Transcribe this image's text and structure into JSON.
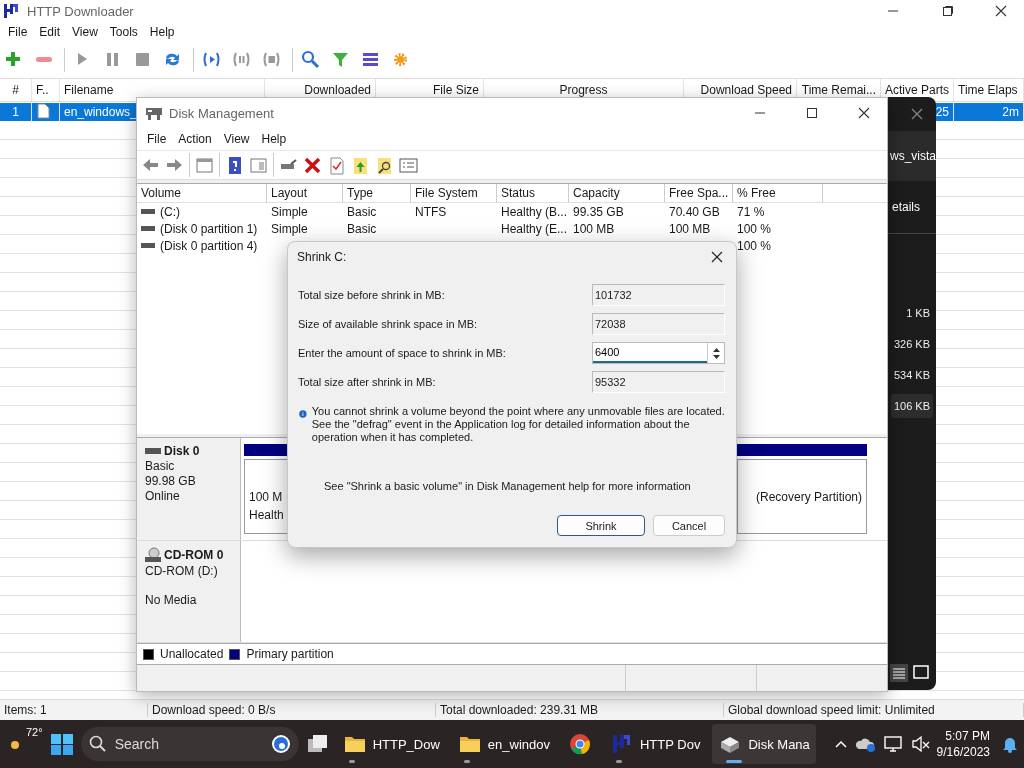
{
  "downloader": {
    "title": "HTTP Downloader",
    "menu": [
      "File",
      "Edit",
      "View",
      "Tools",
      "Help"
    ],
    "columns": [
      "#",
      "F..",
      "Filename",
      "Downloaded",
      "File Size",
      "Progress",
      "Download Speed",
      "Time Remai...",
      "Active Parts",
      "Time Elaps"
    ],
    "rows": [
      {
        "number": "1",
        "filename": "en_windows_",
        "active_parts": "25",
        "time_elapsed": "2m",
        "selected": true
      }
    ],
    "status_bar": [
      "Items: 1",
      "Download speed: 0 B/s",
      "Total downloaded: 239.31 MB",
      "Global download speed limit: Unlimited"
    ]
  },
  "explorer": {
    "title": "ws_vista",
    "tab": "etails",
    "sizes": [
      {
        "text": "1 KB",
        "selected": false
      },
      {
        "text": "326 KB",
        "selected": false
      },
      {
        "text": "534 KB",
        "selected": false
      },
      {
        "text": "106 KB",
        "selected": true
      }
    ]
  },
  "disk_management": {
    "title": "Disk Management",
    "menu": [
      "File",
      "Action",
      "View",
      "Help"
    ],
    "columns": [
      "Volume",
      "Layout",
      "Type",
      "File System",
      "Status",
      "Capacity",
      "Free Spa...",
      "% Free"
    ],
    "volumes": [
      {
        "volume": "(C:)",
        "layout": "Simple",
        "type": "Basic",
        "file_system": "NTFS",
        "status": "Healthy (B...",
        "capacity": "99.35 GB",
        "free_space": "70.40 GB",
        "percent_free": "71 %"
      },
      {
        "volume": "(Disk 0 partition 1)",
        "layout": "Simple",
        "type": "Basic",
        "status": "Healthy (E...",
        "capacity": "100 MB",
        "free_space": "100 MB",
        "percent_free": "100 %"
      },
      {
        "volume": "(Disk 0 partition 4)",
        "percent_free": "100 %"
      }
    ],
    "disks": [
      {
        "kind": "disk",
        "name": "Disk 0",
        "lines": [
          "Basic",
          "99.98 GB",
          "Online"
        ],
        "partitions": [
          {
            "size": "100 M",
            "status": "Health"
          },
          {
            "status": "(Recovery Partition)"
          }
        ]
      },
      {
        "kind": "cdrom",
        "name": "CD-ROM 0",
        "lines": [
          "CD-ROM (D:)",
          "No Media"
        ]
      }
    ],
    "legend": [
      {
        "label": "Unallocated",
        "color": "#000000"
      },
      {
        "label": "Primary partition",
        "color": "#000080"
      }
    ]
  },
  "dialog": {
    "title": "Shrink C:",
    "fields": [
      {
        "label": "Total size before shrink in MB:",
        "value": "101732",
        "kind": "readonly"
      },
      {
        "label": "Size of available shrink space in MB:",
        "value": "72038",
        "kind": "readonly"
      },
      {
        "label": "Enter the amount of space to shrink in MB:",
        "value": "6400",
        "kind": "spin"
      },
      {
        "label": "Total size after shrink in MB:",
        "value": "95332",
        "kind": "readonly"
      }
    ],
    "info": "You cannot shrink a volume beyond the point where any unmovable files are located. See the \"defrag\" event in the Application log for detailed information about the operation when it has completed.",
    "help": "See \"Shrink a basic volume\" in Disk Management help for more information",
    "buttons": [
      {
        "label": "Shrink",
        "default": true
      },
      {
        "label": "Cancel",
        "default": false
      }
    ]
  },
  "taskbar": {
    "weather": "72°",
    "search_placeholder": "Search",
    "apps": [
      {
        "kind": "folder",
        "label": "HTTP_Dow",
        "running": true,
        "active": false
      },
      {
        "kind": "folder",
        "label": "en_windov",
        "running": true,
        "active": false
      },
      {
        "kind": "browser",
        "running": false,
        "active": false
      },
      {
        "kind": "downloader",
        "label": "HTTP Dov",
        "running": true,
        "active": false
      },
      {
        "kind": "disk",
        "label": "Disk Mana",
        "running": true,
        "active": true
      }
    ],
    "time": "5:07 PM",
    "date": "9/16/2023"
  }
}
